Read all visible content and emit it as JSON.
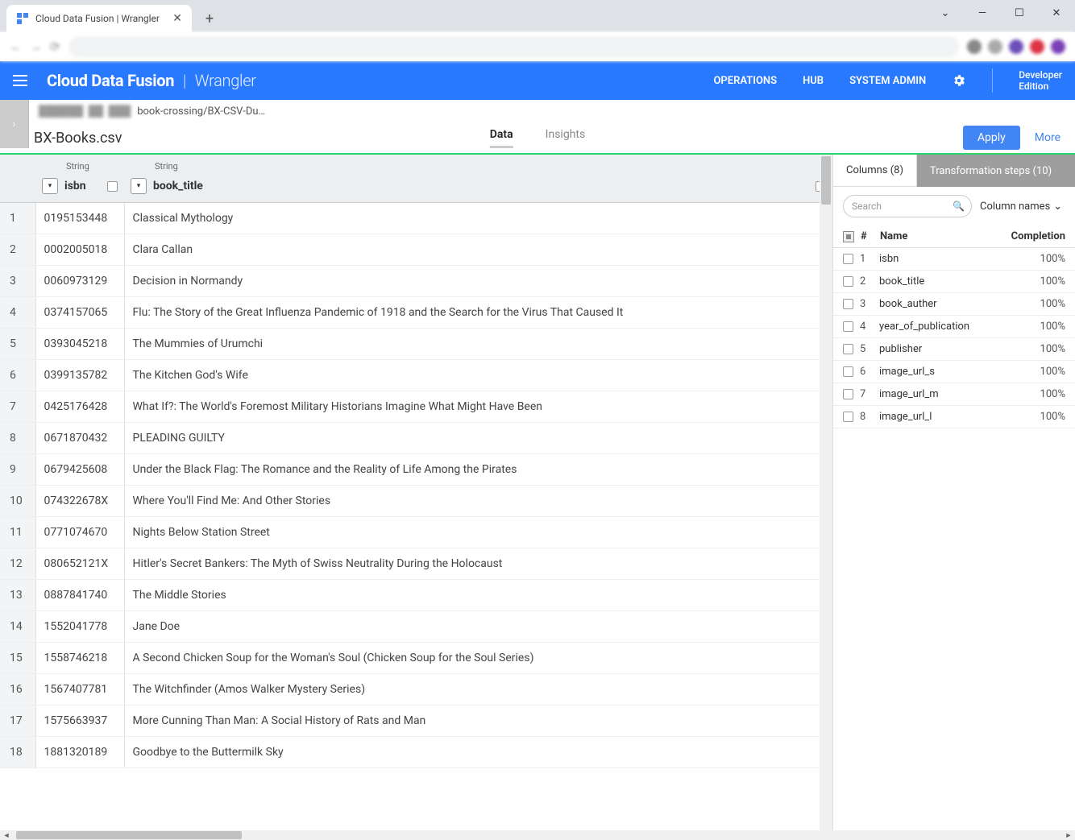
{
  "browser": {
    "tab_title": "Cloud Data Fusion | Wrangler",
    "window_controls": {
      "down": "⌄",
      "min": "—",
      "max": "☐",
      "close": "✕"
    }
  },
  "header": {
    "product": "Cloud Data Fusion",
    "section": "Wrangler",
    "nav": {
      "operations": "OPERATIONS",
      "hub": "HUB",
      "system_admin": "SYSTEM ADMIN"
    },
    "developer_edition": "Developer\nEdition"
  },
  "breadcrumb": {
    "path": "book-crossing/BX-CSV-Du…"
  },
  "subheader": {
    "filename": "BX-Books.csv",
    "tab_data": "Data",
    "tab_insights": "Insights",
    "apply": "Apply",
    "more": "More"
  },
  "columns_header": {
    "type_label": "String",
    "isbn": "isbn",
    "book_title": "book_title"
  },
  "rows": [
    {
      "n": "1",
      "isbn": "0195153448",
      "title": "Classical Mythology"
    },
    {
      "n": "2",
      "isbn": "0002005018",
      "title": "Clara Callan"
    },
    {
      "n": "3",
      "isbn": "0060973129",
      "title": "Decision in Normandy"
    },
    {
      "n": "4",
      "isbn": "0374157065",
      "title": "Flu: The Story of the Great Influenza Pandemic of 1918 and the Search for the Virus That Caused It"
    },
    {
      "n": "5",
      "isbn": "0393045218",
      "title": "The Mummies of Urumchi"
    },
    {
      "n": "6",
      "isbn": "0399135782",
      "title": "The Kitchen God's Wife"
    },
    {
      "n": "7",
      "isbn": "0425176428",
      "title": "What If?: The World's Foremost Military Historians Imagine What Might Have Been"
    },
    {
      "n": "8",
      "isbn": "0671870432",
      "title": "PLEADING GUILTY"
    },
    {
      "n": "9",
      "isbn": "0679425608",
      "title": "Under the Black Flag: The Romance and the Reality of Life Among the Pirates"
    },
    {
      "n": "10",
      "isbn": "074322678X",
      "title": "Where You'll Find Me: And Other Stories"
    },
    {
      "n": "11",
      "isbn": "0771074670",
      "title": "Nights Below Station Street"
    },
    {
      "n": "12",
      "isbn": "080652121X",
      "title": "Hitler's Secret Bankers: The Myth of Swiss Neutrality During the Holocaust"
    },
    {
      "n": "13",
      "isbn": "0887841740",
      "title": "The Middle Stories"
    },
    {
      "n": "14",
      "isbn": "1552041778",
      "title": "Jane Doe"
    },
    {
      "n": "15",
      "isbn": "1558746218",
      "title": "A Second Chicken Soup for the Woman's Soul (Chicken Soup for the Soul Series)"
    },
    {
      "n": "16",
      "isbn": "1567407781",
      "title": "The Witchfinder (Amos Walker Mystery Series)"
    },
    {
      "n": "17",
      "isbn": "1575663937",
      "title": "More Cunning Than Man: A Social History of Rats and Man"
    },
    {
      "n": "18",
      "isbn": "1881320189",
      "title": "Goodbye to the Buttermilk Sky"
    }
  ],
  "side": {
    "tab_columns": "Columns (8)",
    "tab_transform": "Transformation steps (10)",
    "search_placeholder": "Search",
    "filter_label": "Column names",
    "head_num": "#",
    "head_name": "Name",
    "head_completion": "Completion",
    "cols": [
      {
        "n": "1",
        "name": "isbn",
        "comp": "100%"
      },
      {
        "n": "2",
        "name": "book_title",
        "comp": "100%"
      },
      {
        "n": "3",
        "name": "book_auther",
        "comp": "100%"
      },
      {
        "n": "4",
        "name": "year_of_publication",
        "comp": "100%"
      },
      {
        "n": "5",
        "name": "publisher",
        "comp": "100%"
      },
      {
        "n": "6",
        "name": "image_url_s",
        "comp": "100%"
      },
      {
        "n": "7",
        "name": "image_url_m",
        "comp": "100%"
      },
      {
        "n": "8",
        "name": "image_url_l",
        "comp": "100%"
      }
    ]
  }
}
